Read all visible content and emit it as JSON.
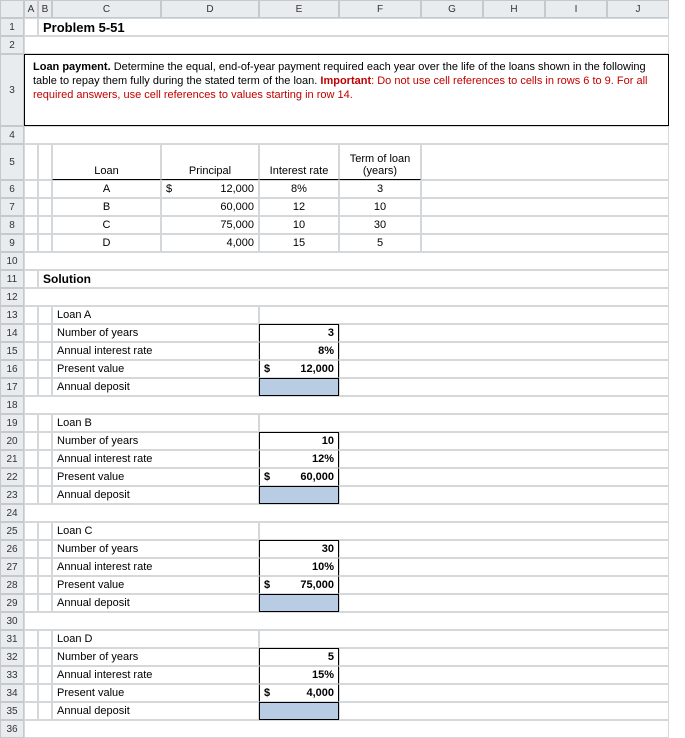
{
  "columns": [
    "A",
    "B",
    "C",
    "D",
    "E",
    "F",
    "G",
    "H",
    "I",
    "J"
  ],
  "rows": [
    "1",
    "2",
    "3",
    "4",
    "5",
    "6",
    "7",
    "8",
    "9",
    "10",
    "11",
    "12",
    "13",
    "14",
    "15",
    "16",
    "17",
    "18",
    "19",
    "20",
    "21",
    "22",
    "23",
    "24",
    "25",
    "26",
    "27",
    "28",
    "29",
    "30",
    "31",
    "32",
    "33",
    "34",
    "35",
    "36"
  ],
  "title": "Problem 5-51",
  "instr_lead": "Loan payment. ",
  "instr_body1": "Determine the equal, end-of-year payment required each year over the life of the loans shown in the following table to repay them fully during the stated term of the loan.  ",
  "instr_important_label": "Important",
  "instr_body2": ": Do not use cell references to cells in rows 6 to 9. For all required answers, use cell references to values starting in row 14.",
  "table": {
    "h_loan": "Loan",
    "h_principal": "Principal",
    "h_rate": "Interest rate",
    "h_term1": "Term of loan",
    "h_term2": "(years)",
    "rows": [
      {
        "loan": "A",
        "dollar": "$",
        "principal": "12,000",
        "rate": "8%",
        "term": "3"
      },
      {
        "loan": "B",
        "dollar": "",
        "principal": "60,000",
        "rate": "12",
        "term": "10"
      },
      {
        "loan": "C",
        "dollar": "",
        "principal": "75,000",
        "rate": "10",
        "term": "30"
      },
      {
        "loan": "D",
        "dollar": "",
        "principal": "4,000",
        "rate": "15",
        "term": "5"
      }
    ]
  },
  "solution_label": "Solution",
  "labels": {
    "years": "Number of years",
    "rate": "Annual interest rate",
    "pv": "Present value",
    "dep": "Annual deposit"
  },
  "loans": {
    "A": {
      "title": "Loan A",
      "years": "3",
      "rate": "8%",
      "dollar": "$",
      "pv": "12,000"
    },
    "B": {
      "title": "Loan B",
      "years": "10",
      "rate": "12%",
      "dollar": "$",
      "pv": "60,000"
    },
    "C": {
      "title": "Loan C",
      "years": "30",
      "rate": "10%",
      "dollar": "$",
      "pv": "75,000"
    },
    "D": {
      "title": "Loan D",
      "years": "5",
      "rate": "15%",
      "dollar": "$",
      "pv": "4,000"
    }
  }
}
